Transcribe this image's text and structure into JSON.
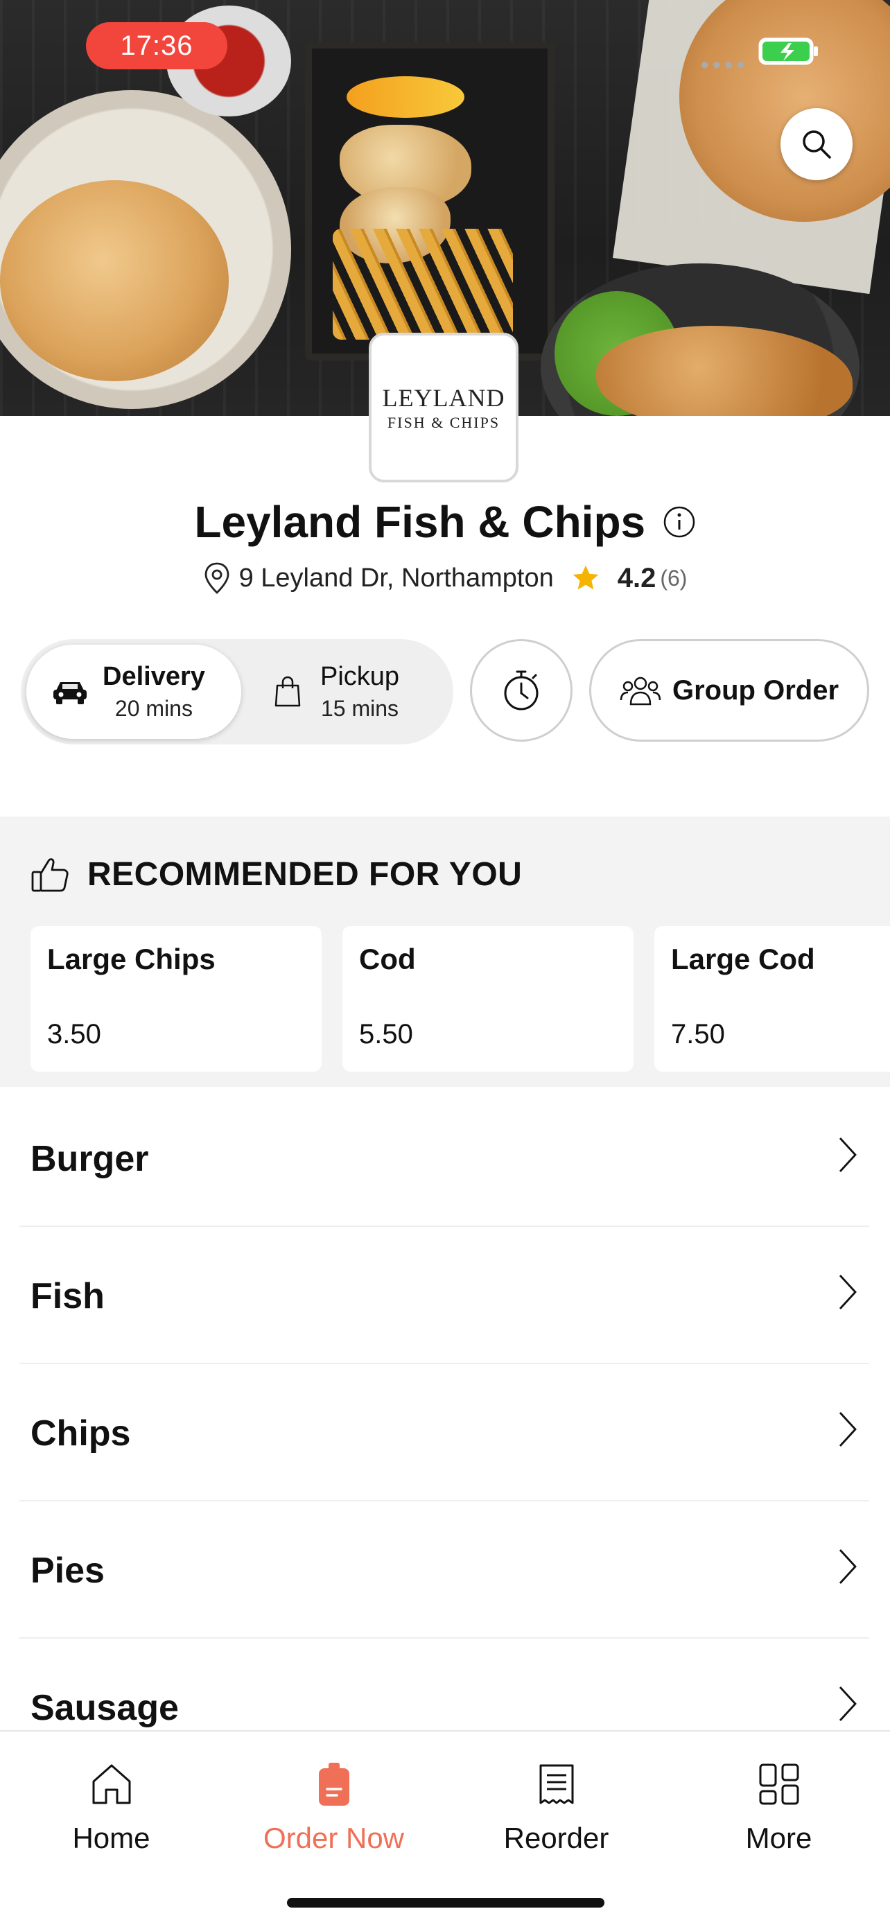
{
  "status_bar": {
    "time": "17:36"
  },
  "restaurant": {
    "logo_line1": "LEYLAND",
    "logo_line2": "FISH & CHIPS",
    "name": "Leyland Fish & Chips",
    "address": "9 Leyland Dr, Northampton",
    "rating": "4.2",
    "rating_count": "(6)"
  },
  "order_mode": {
    "delivery": {
      "label": "Delivery",
      "time": "20 mins",
      "selected": true
    },
    "pickup": {
      "label": "Pickup",
      "time": "15 mins",
      "selected": false
    }
  },
  "group_order_label": "Group Order",
  "recommended": {
    "heading": "RECOMMENDED FOR YOU",
    "items": [
      {
        "name": "Large Chips",
        "price": "3.50"
      },
      {
        "name": "Cod",
        "price": "5.50"
      },
      {
        "name": "Large Cod",
        "price": "7.50"
      }
    ]
  },
  "categories": [
    "Burger",
    "Fish",
    "Chips",
    "Pies",
    "Sausage"
  ],
  "tabs": [
    {
      "label": "Home",
      "icon": "home-icon"
    },
    {
      "label": "Order Now",
      "icon": "order-icon",
      "active": true
    },
    {
      "label": "Reorder",
      "icon": "receipt-icon"
    },
    {
      "label": "More",
      "icon": "grid-icon"
    }
  ],
  "colors": {
    "accent": "#ef7056",
    "time_pill": "#f2463d",
    "star": "#f5b400",
    "battery": "#3ccf4e"
  }
}
